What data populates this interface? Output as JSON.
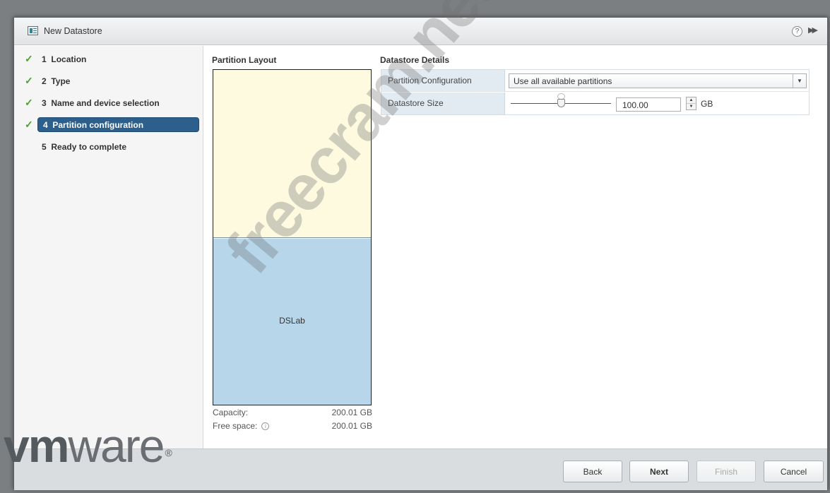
{
  "window": {
    "title": "New Datastore",
    "help_glyph": "?",
    "expand_glyph": "▶▶"
  },
  "steps": [
    {
      "number": "1",
      "label": "Location",
      "completed": true,
      "active": false
    },
    {
      "number": "2",
      "label": "Type",
      "completed": true,
      "active": false
    },
    {
      "number": "3",
      "label": "Name and device selection",
      "completed": true,
      "active": false
    },
    {
      "number": "4",
      "label": "Partition configuration",
      "completed": true,
      "active": true
    },
    {
      "number": "5",
      "label": "Ready to complete",
      "completed": false,
      "active": false
    }
  ],
  "partition_layout": {
    "title": "Partition Layout",
    "datastore_name": "DSLab",
    "capacity_label": "Capacity:",
    "capacity_value": "200.01 GB",
    "free_space_label": "Free space:",
    "free_space_value": "200.01 GB"
  },
  "datastore_details": {
    "title": "Datastore Details",
    "partition_configuration_label": "Partition Configuration",
    "partition_configuration_value": "Use all available partitions",
    "datastore_size_label": "Datastore Size",
    "datastore_size_value": "100.00",
    "datastore_size_unit": "GB",
    "slider_level": 0.5
  },
  "footer": {
    "back_label": "Back",
    "next_label": "Next",
    "finish_label": "Finish",
    "cancel_label": "Cancel"
  },
  "branding": {
    "logo_text_bold": "vm",
    "logo_text_light": "ware",
    "logo_mark": "®"
  },
  "watermark_text": "freecram.net",
  "colors": {
    "active_step": "#2c5f8c",
    "check": "#4aa12c",
    "free_partition": "#fdfae0",
    "used_partition": "#b7d6ea",
    "label_cell": "#e3ebf2"
  }
}
